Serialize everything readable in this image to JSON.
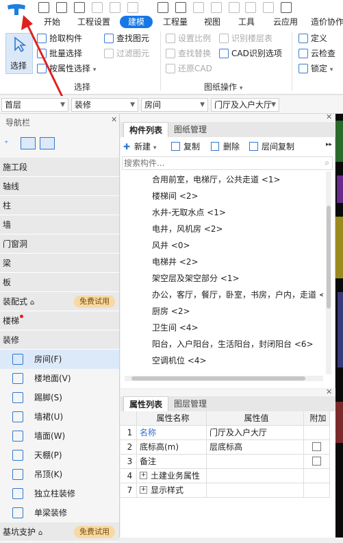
{
  "menu": {
    "tabs": [
      "开始",
      "工程设置",
      "建模",
      "工程量",
      "视图",
      "工具",
      "云应用",
      "造价协作"
    ],
    "active": "建模"
  },
  "ribbon": {
    "select_big": "选择",
    "pick_component": "拾取构件",
    "batch_select": "批量选择",
    "by_attr_select": "按属性选择",
    "group_select": "选择",
    "find_element": "查找图元",
    "filter_element": "过滤图元",
    "set_scale": "设置比例",
    "find_replace": "查找替换",
    "restore_cad": "还原CAD",
    "identify_floor_table": "识别楼层表",
    "cad_identify_options": "CAD识别选项",
    "group_drawing_ops": "图纸操作",
    "define": "定义",
    "cloud_check": "云检查",
    "lock": "锁定"
  },
  "selectors": {
    "floor": "首层",
    "category": "装修",
    "type": "房间",
    "component": "门厅及入户大厅"
  },
  "nav": {
    "title": "导航栏",
    "categories": {
      "construction": "施工段",
      "axis": "轴线",
      "column": "柱",
      "wall": "墙",
      "door_window": "门窗洞",
      "beam": "梁",
      "slab": "板",
      "prefab": "装配式",
      "stairs": "楼梯",
      "decoration": "装修",
      "foundation_pit": "基坑支护"
    },
    "free_trial": "免费试用",
    "items": [
      "房间(F)",
      "楼地面(V)",
      "踢脚(S)",
      "墙裙(U)",
      "墙面(W)",
      "天棚(P)",
      "吊顶(K)",
      "独立柱装修",
      "单梁装修"
    ]
  },
  "component_panel": {
    "tabs": [
      "构件列表",
      "图纸管理"
    ],
    "toolbar": {
      "new": "新建",
      "copy": "复制",
      "delete": "删除",
      "floor_copy": "层间复制"
    },
    "search_placeholder": "搜索构件...",
    "items": [
      "合用前室，电梯厅，公共走道 <1>",
      "楼梯间 <2>",
      "水井-无取水点 <1>",
      "电井，风机房 <2>",
      "风井 <0>",
      "电梯井 <2>",
      "架空层及架空部分 <1>",
      "办公，客厅，餐厅，卧室，书房，户内，走道 <",
      "厨房 <2>",
      "卫生间 <4>",
      "阳台，入户阳台，生活阳台，封闭阳台 <6>",
      "空调机位 <4>"
    ]
  },
  "prop_panel": {
    "tabs": [
      "属性列表",
      "图层管理"
    ],
    "headers": {
      "name": "属性名称",
      "value": "属性值",
      "attach": "附加"
    },
    "rows": [
      {
        "num": "1",
        "name": "名称",
        "value": "门厅及入户大厅"
      },
      {
        "num": "2",
        "name": "底标高(m)",
        "value": "层底标高"
      },
      {
        "num": "3",
        "name": "备注",
        "value": ""
      },
      {
        "num": "4",
        "name": "土建业务属性",
        "value": ""
      },
      {
        "num": "7",
        "name": "显示样式",
        "value": ""
      }
    ]
  },
  "colors": {
    "accent": "#1677e6",
    "badge_bg": "#f7d9a6",
    "arrow": "#e02020"
  }
}
